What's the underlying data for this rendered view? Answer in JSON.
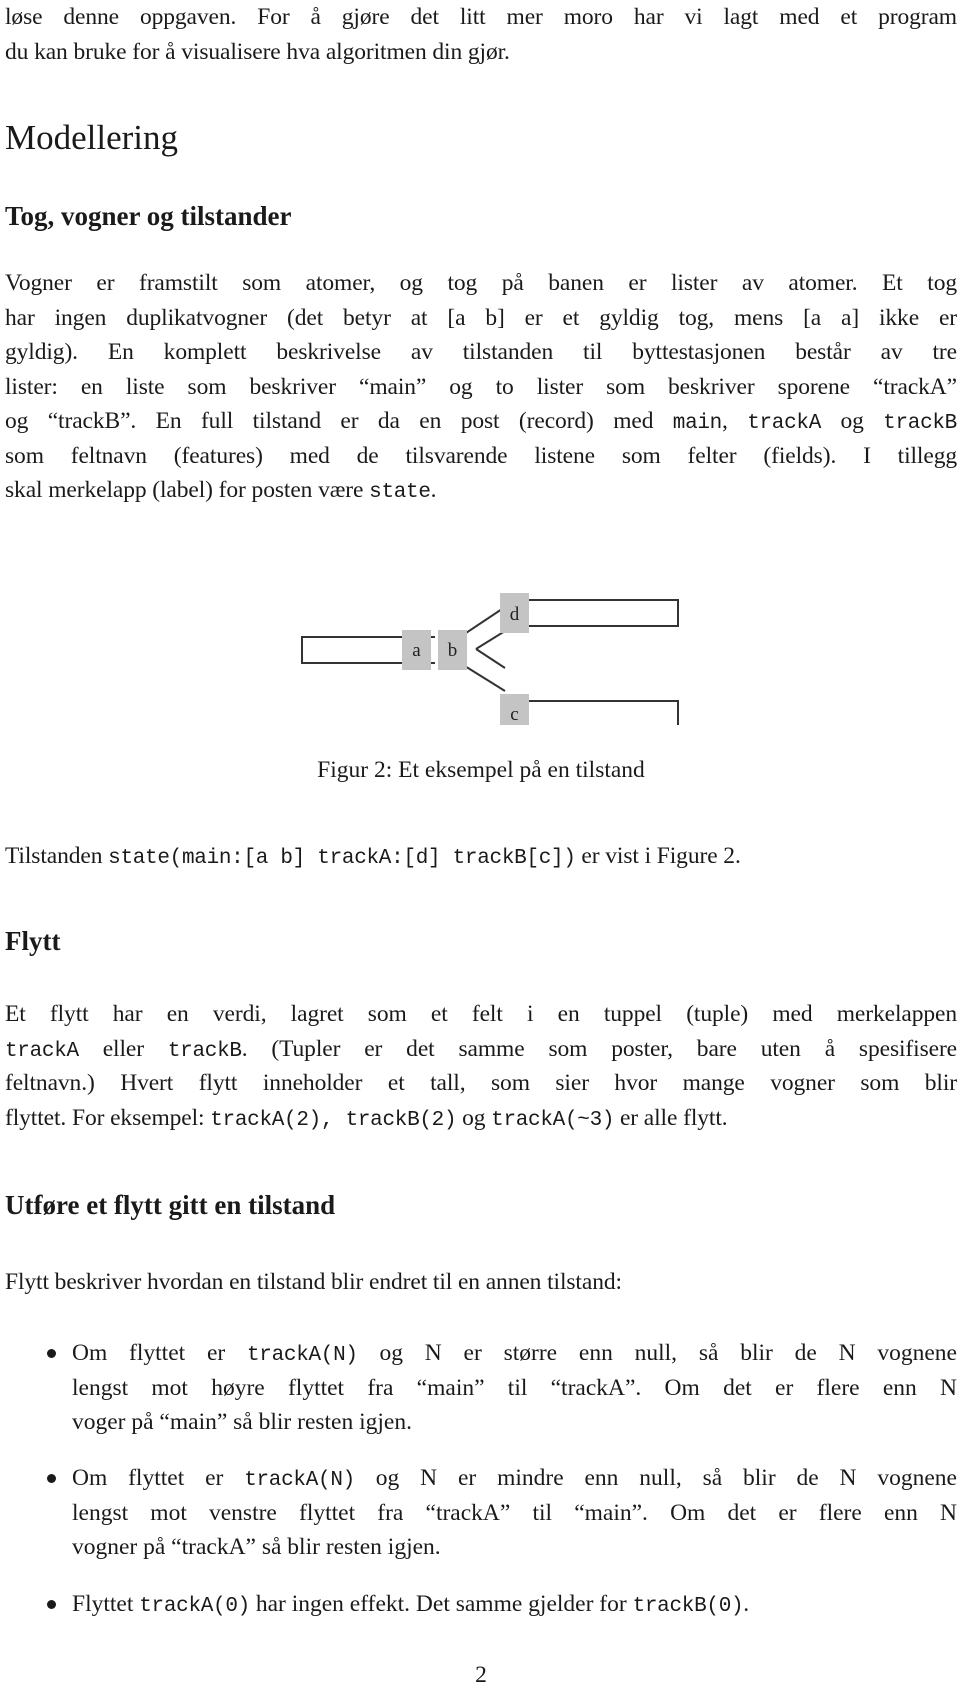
{
  "intro": {
    "lines": [
      "løse denne oppgaven.  For å gjøre det litt mer moro har vi lagt med et program",
      "du kan bruke for å visualisere hva algoritmen din gjør."
    ]
  },
  "section": {
    "title": "Modellering"
  },
  "subsection1": {
    "title": "Tog, vogner og tilstander",
    "paragraph": {
      "line1": "Vogner er framstilt som atomer, og tog på banen er lister av atomer.  Et tog",
      "line2": "har ingen duplikatvogner (det betyr at [a b] er et gyldig tog, mens [a a] ikke er",
      "line3": "gyldig).  En komplett beskrivelse av tilstanden til byttestasjonen består av tre",
      "line4": "lister: en liste som beskriver “main” og to lister som beskriver sporene “trackA”",
      "line5_a": "og “trackB”. En full tilstand er da en post (record) med ",
      "line5_code1": "main",
      "line5_b": ", ",
      "line5_code2": "trackA",
      "line5_c": " og ",
      "line5_code3": "trackB",
      "line6": "som feltnavn (features) med de tilsvarende listene som felter (fields).  I tillegg",
      "line7_a": "skal merkelapp (label) for posten være ",
      "line7_code": "state",
      "line7_b": "."
    }
  },
  "figure": {
    "wagons": {
      "a": "a",
      "b": "b",
      "c": "c",
      "d": "d"
    },
    "caption": "Figur 2: Et eksempel på en tilstand",
    "colors": {
      "wagon_fill": "#c4c4c4",
      "track_stroke": "#333333"
    }
  },
  "state_example": {
    "prefix": "Tilstanden ",
    "code": "state(main:[a b] trackA:[d] trackB[c])",
    "suffix": " er vist i Figure 2."
  },
  "subsection2": {
    "title": "Flytt",
    "paragraph": {
      "line1": "Et flytt har en verdi, lagret som et felt i en tuppel (tuple) med merkelappen",
      "line2_code1": "trackA",
      "line2_a": " eller ",
      "line2_code2": "trackB",
      "line2_b": ". (Tupler er det samme som poster, bare uten å spesifisere",
      "line3": "feltnavn.)  Hvert flytt inneholder et tall, som sier hvor mange vogner som blir",
      "line4_a": "flyttet. For eksempel: ",
      "line4_code1": "trackA(2), trackB(2)",
      "line4_b": " og ",
      "line4_code2": "trackA(~3)",
      "line4_c": " er alle flytt."
    }
  },
  "subsection3": {
    "title": "Utføre et flytt gitt en tilstand",
    "intro": "Flytt beskriver hvordan en tilstand blir endret til en annen tilstand:",
    "bullets": [
      {
        "l1_a": "Om flyttet er ",
        "l1_code": "trackA(N)",
        "l1_b": " og N er større enn null, så blir de N vognene",
        "l2": "lengst mot høyre flyttet fra “main” til “trackA”.  Om det er flere enn N",
        "l3": "voger på “main” så blir resten igjen."
      },
      {
        "l1_a": "Om flyttet er ",
        "l1_code": "trackA(N)",
        "l1_b": " og N er mindre enn null, så blir de N vognene",
        "l2": "lengst mot venstre flyttet fra “trackA” til “main”.  Om det er flere enn N",
        "l3": "vogner på “trackA” så blir resten igjen."
      },
      {
        "l1_a": "Flyttet ",
        "l1_code": "trackA(0)",
        "l1_b": " har ingen effekt. Det samme gjelder for ",
        "l1_code2": "trackB(0)",
        "l1_c": "."
      }
    ]
  },
  "footer": {
    "page_number": "2"
  }
}
